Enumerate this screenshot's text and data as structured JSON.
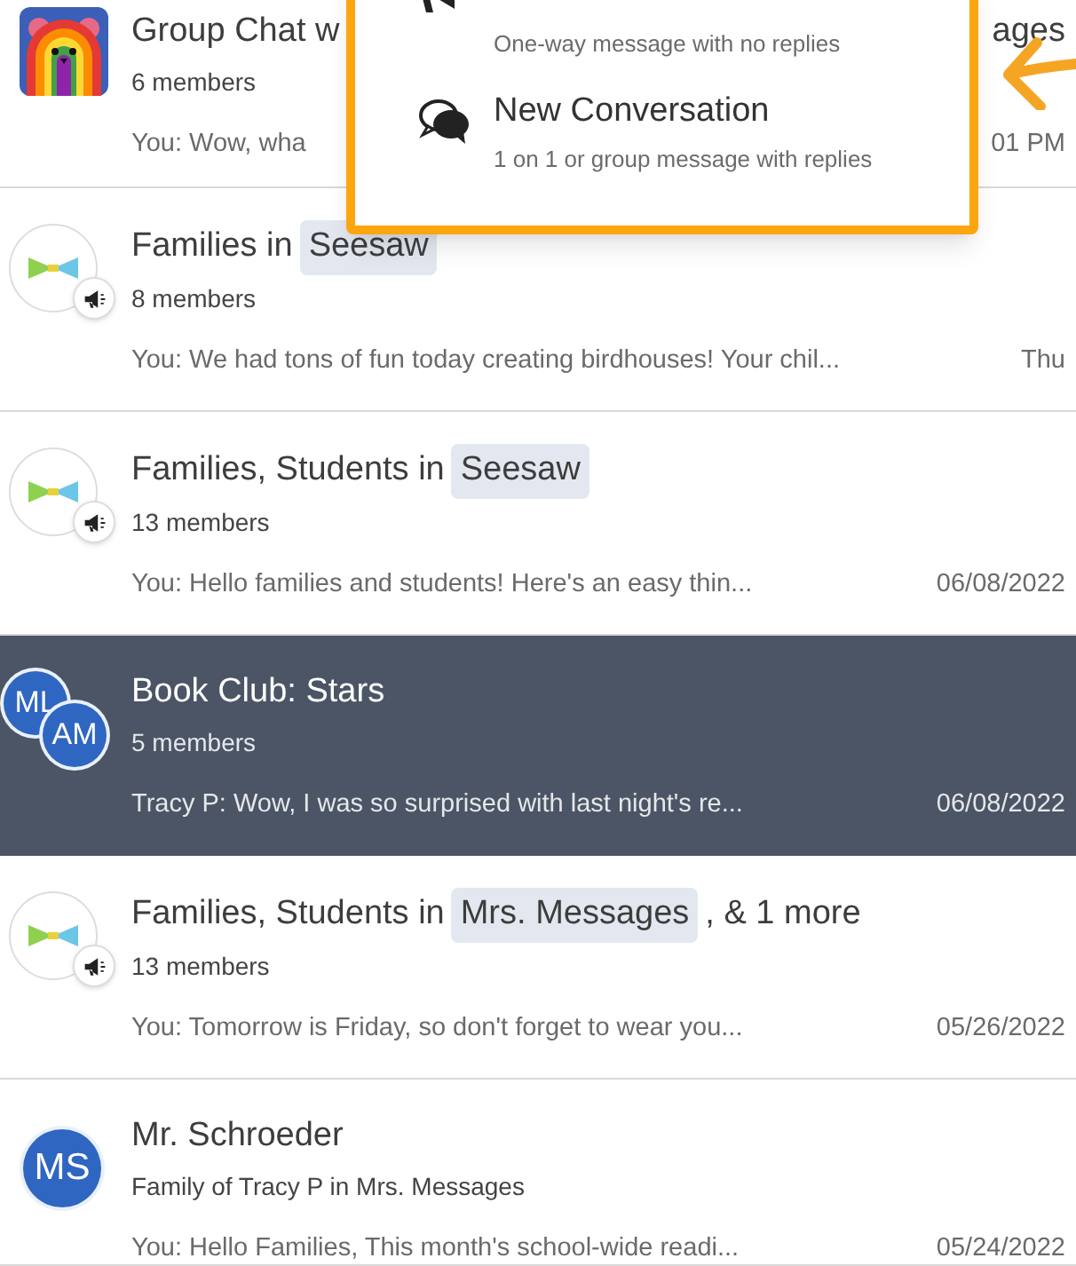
{
  "menu": {
    "items": [
      {
        "kind": "announcement",
        "subtitle": "One-way message with no replies"
      },
      {
        "kind": "conversation",
        "title": "New Conversation",
        "subtitle": "1 on 1 or group message with replies"
      }
    ]
  },
  "conversations": [
    {
      "avatar": {
        "kind": "bear"
      },
      "title": "Group Chat w",
      "title_right": "ages",
      "subtitle": "6 members",
      "preview": "You: Wow, wha",
      "time": "01 PM",
      "selected": false,
      "announcement": false
    },
    {
      "avatar": {
        "kind": "class"
      },
      "title": "Families in",
      "tag": "Seesaw",
      "subtitle": "8 members",
      "preview": "You: We had tons of fun today creating birdhouses! Your chil...",
      "time": "Thu",
      "selected": false,
      "announcement": true
    },
    {
      "avatar": {
        "kind": "class"
      },
      "title": "Families, Students in",
      "tag": "Seesaw",
      "subtitle": "13 members",
      "preview": "You: Hello families and students! Here's an easy thin...",
      "time": "06/08/2022",
      "selected": false,
      "announcement": true
    },
    {
      "avatar": {
        "kind": "pair",
        "initials": [
          "ML",
          "AM"
        ]
      },
      "title": "Book Club: Stars",
      "subtitle": "5 members",
      "preview": "Tracy P: Wow, I was so surprised with last night's re...",
      "time": "06/08/2022",
      "selected": true,
      "announcement": false
    },
    {
      "avatar": {
        "kind": "class"
      },
      "title": "Families, Students in",
      "tag": "Mrs. Messages",
      "title_suffix": ", & 1 more",
      "subtitle": "13 members",
      "preview": "You: Tomorrow is Friday, so don't forget to wear you...",
      "time": "05/26/2022",
      "selected": false,
      "announcement": true
    },
    {
      "avatar": {
        "kind": "initials",
        "initials": [
          "MS"
        ]
      },
      "title": "Mr. Schroeder",
      "subtitle": "Family of Tracy P in Mrs. Messages",
      "preview": "You: Hello Families, This month's school-wide readi...",
      "time": "05/24/2022",
      "selected": false,
      "announcement": false
    }
  ]
}
